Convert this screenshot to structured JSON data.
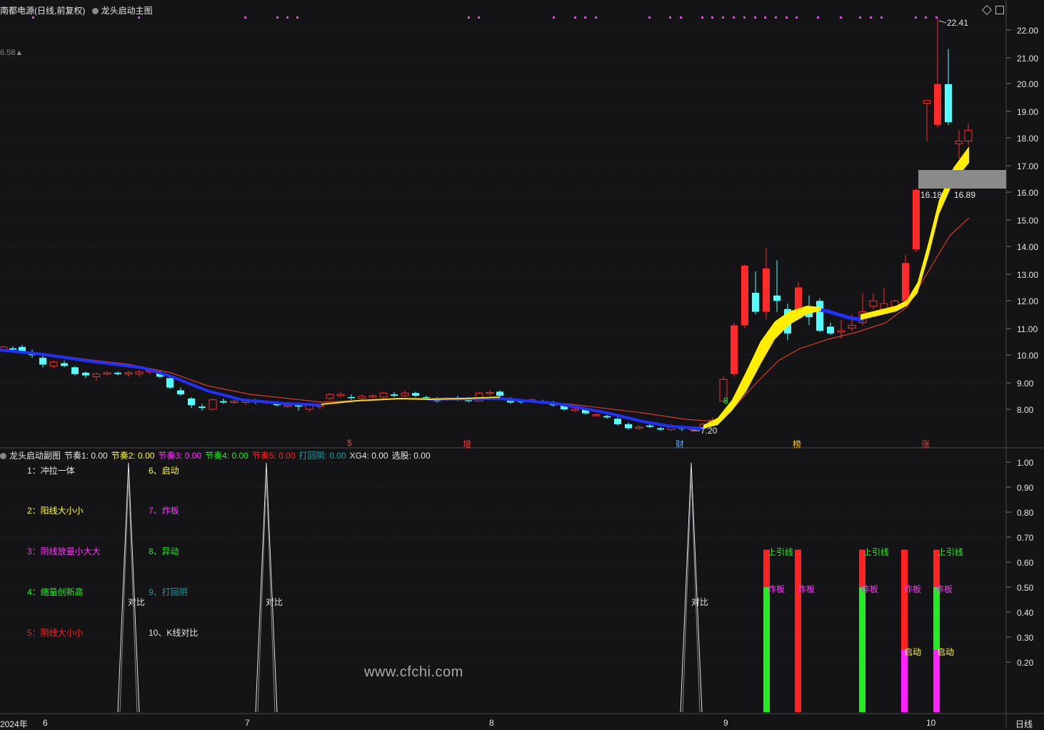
{
  "header": {
    "title": "南都电源(日线,前复权)",
    "indicator": "龙头启动主图",
    "left_value": "6.58▲"
  },
  "price_axis": {
    "labels": [
      "22.00",
      "21.00",
      "20.00",
      "19.00",
      "18.00",
      "17.00",
      "16.00",
      "15.00",
      "14.00",
      "13.00",
      "12.00",
      "11.00",
      "10.00",
      "9.00",
      "8.00"
    ]
  },
  "chart_annotations": {
    "high_label": "22.41",
    "low_label": "7.20",
    "box_label_left": "16.18",
    "box_label_right": "16.89",
    "marker_8": "8"
  },
  "events": [
    {
      "label": "$",
      "color": "#ff3333"
    },
    {
      "label": "增",
      "color": "#ff3333"
    },
    {
      "label": "财",
      "color": "#5aa8ff"
    },
    {
      "label": "榜",
      "color": "#ffcc00"
    },
    {
      "label": "涨",
      "color": "#ff3333"
    }
  ],
  "sub_header": {
    "name": "龙头启动副图",
    "items": [
      {
        "text": "节奏1: 0.00",
        "color": "#e6e6e6"
      },
      {
        "text": "节奏2: 0.00",
        "color": "#ffff33"
      },
      {
        "text": "节奏3: 0.00",
        "color": "#ff33ff"
      },
      {
        "text": "节奏4: 0.00",
        "color": "#22ee22"
      },
      {
        "text": "节奏5: 0.00",
        "color": "#ff2222"
      },
      {
        "text": "打回阴: 0.00",
        "color": "#14a0a0"
      },
      {
        "text": "XG4: 0.00",
        "color": "#e6e6e6"
      },
      {
        "text": "选股: 0.00",
        "color": "#e6e6e6"
      }
    ]
  },
  "sub_axis": {
    "labels": [
      "1.00",
      "0.90",
      "0.80",
      "0.70",
      "0.60",
      "0.50",
      "0.40",
      "0.30",
      "0.20"
    ]
  },
  "legend": [
    {
      "text": "1：冲拉一体",
      "color": "#e6e6e6"
    },
    {
      "text": "2：阳线大小小",
      "color": "#ffff33"
    },
    {
      "text": "3：阴线放量小大大",
      "color": "#ff33ff"
    },
    {
      "text": "4：缩量创新高",
      "color": "#22ee22"
    },
    {
      "text": "5：阴线大小小",
      "color": "#ff2222"
    },
    {
      "text": "6、启动",
      "color": "#ffff33"
    },
    {
      "text": "7、炸板",
      "color": "#ff33ff"
    },
    {
      "text": "8、异动",
      "color": "#22ee22"
    },
    {
      "text": "9、打回阴",
      "color": "#14a0a0"
    },
    {
      "text": "10、K线对比",
      "color": "#e6e6e6"
    }
  ],
  "sub_labels": {
    "compare": "对比",
    "upper_shadow": "上引线",
    "burst": "炸板",
    "start": "启动"
  },
  "watermark": "www.cfchi.com",
  "date_axis": {
    "year": "2024年",
    "months": [
      "6",
      "7",
      "8",
      "9",
      "10"
    ],
    "period": "日线"
  }
}
